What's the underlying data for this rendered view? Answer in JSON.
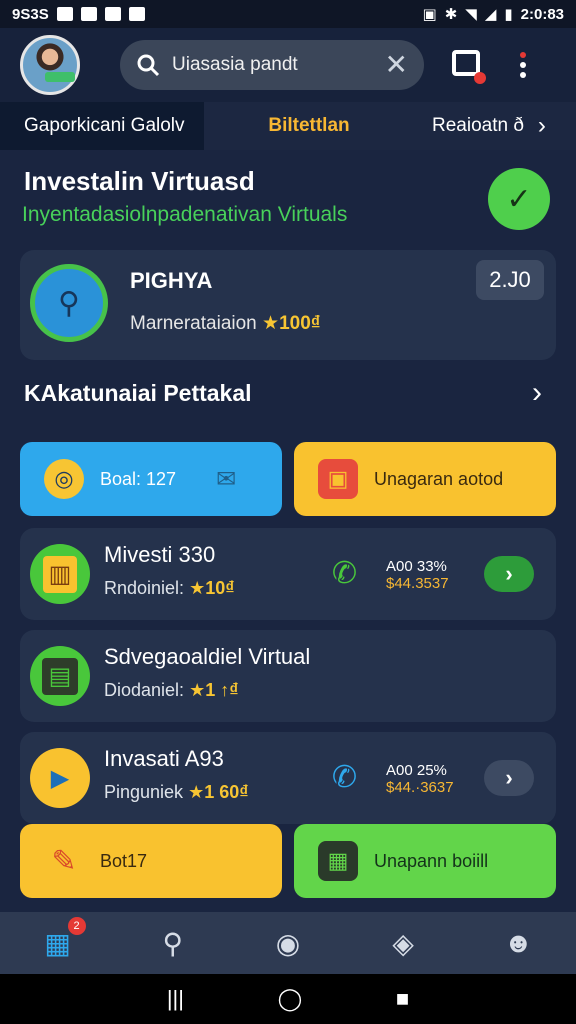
{
  "status": {
    "time_left": "9S3S",
    "time_right": "2:0:83"
  },
  "header": {
    "search_text": "Uiasasia pandt",
    "clear_icon": "close-icon"
  },
  "tabs": [
    {
      "label": "Gaporkicani Galolv"
    },
    {
      "label": "Biltettlan"
    },
    {
      "label": "Reaioatn ð"
    }
  ],
  "section": {
    "title": "Investalin Virtuasd",
    "subtitle": "Inyentadasiolnpadenativan Virtuals"
  },
  "profile_card": {
    "title": "PIGHYA",
    "sub_label": "Marnerataiaion",
    "sub_value": "★100₫",
    "badge": "2.J0"
  },
  "row": {
    "title": "KAkatunaiai Pettakal"
  },
  "actions_top": {
    "blue_label": "Boal: 127",
    "yellow_label": "Unagaran aotod"
  },
  "list": [
    {
      "title": "Mivesti 330",
      "sub_label": "Rndoiniel:",
      "sub_value": "★10₫",
      "stat_a": "A00 33%",
      "stat_b": "$44.3537"
    },
    {
      "title": "Sdvegaoaldiel Virtual",
      "sub_label": "Diodaniel:",
      "sub_value": "★1 ↑₫"
    },
    {
      "title": "Invasati A93",
      "sub_label": "Pinguniek",
      "sub_value": "★1 60₫",
      "stat_a": "A00 25%",
      "stat_b": "$44.·3637"
    }
  ],
  "actions_bottom": {
    "yellow_label": "Bot17",
    "green_label": "Unapann boiill"
  },
  "nav": {
    "badge": "2"
  },
  "colors": {
    "background": "#1a2540",
    "accent_yellow": "#f9c22f",
    "accent_green": "#62d54a",
    "accent_blue": "#2ea8ec"
  }
}
